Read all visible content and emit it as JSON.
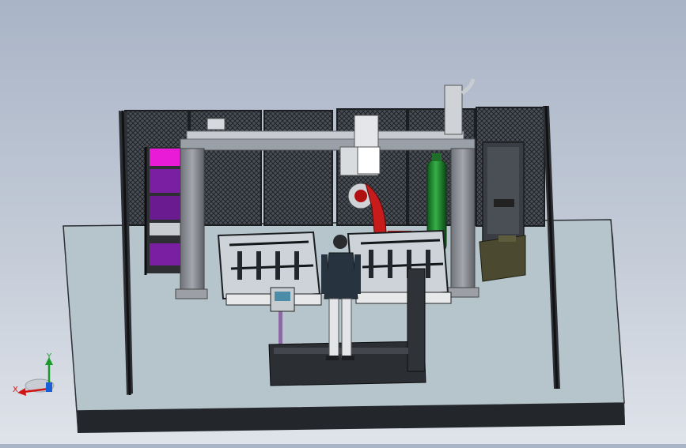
{
  "viewport": {
    "background_colors": [
      "#a9b4c6",
      "#dfe3ea"
    ],
    "model": "robotic-welding-cell",
    "colors": {
      "platform_top": "#b6c5cb",
      "platform_side": "#23262a",
      "gantry": "#8a8e93",
      "robot": "#c81c1c",
      "gas_cylinder": "#1f8a2c",
      "shelf": "#7b1fa2",
      "shelf_top": "#ea1bd6",
      "control_cabinet": "#3a3e44",
      "wire_feeder": "#4b4a30",
      "fence_mesh": "#3c4048"
    }
  },
  "triad": {
    "x_label": "X",
    "y_label": "Y",
    "x_color": "#d11414",
    "y_color": "#1a9a2a",
    "z_color": "#1b5fd6"
  }
}
